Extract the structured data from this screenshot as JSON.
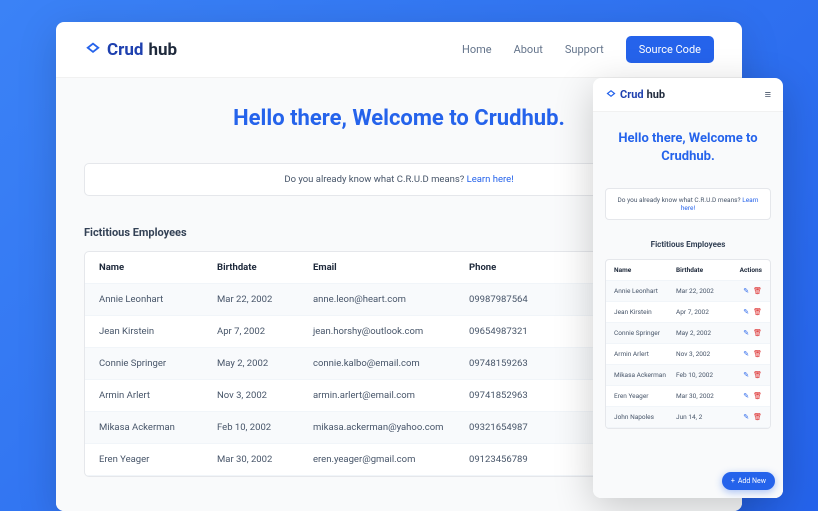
{
  "brand": {
    "name_a": "Crud",
    "name_b": "hub"
  },
  "nav": {
    "home": "Home",
    "about": "About",
    "support": "Support",
    "source": "Source Code"
  },
  "hero": "Hello there, Welcome to Crudhub.",
  "info": {
    "text": "Do you already know what C.R.U.D means? ",
    "link": "Learn here!"
  },
  "section_title": "Fictitious Employees",
  "columns": {
    "name": "Name",
    "birthdate": "Birthdate",
    "email": "Email",
    "phone": "Phone",
    "actions": "Actions"
  },
  "employees": [
    {
      "name": "Annie Leonhart",
      "birthdate": "Mar 22, 2002",
      "email": "anne.leon@heart.com",
      "phone": "09987987564"
    },
    {
      "name": "Jean Kirstein",
      "birthdate": "Apr 7, 2002",
      "email": "jean.horshy@outlook.com",
      "phone": "09654987321"
    },
    {
      "name": "Connie Springer",
      "birthdate": "May 2, 2002",
      "email": "connie.kalbo@email.com",
      "phone": "09748159263"
    },
    {
      "name": "Armin Arlert",
      "birthdate": "Nov 3, 2002",
      "email": "armin.arlert@email.com",
      "phone": "09741852963"
    },
    {
      "name": "Mikasa Ackerman",
      "birthdate": "Feb 10, 2002",
      "email": "mikasa.ackerman@yahoo.com",
      "phone": "09321654987"
    },
    {
      "name": "Eren Yeager",
      "birthdate": "Mar 30, 2002",
      "email": "eren.yeager@gmail.com",
      "phone": "09123456789"
    }
  ],
  "mobile_extra": {
    "name": "John Napoles",
    "birthdate": "Jun 14, 2"
  },
  "add_new": "Add New"
}
